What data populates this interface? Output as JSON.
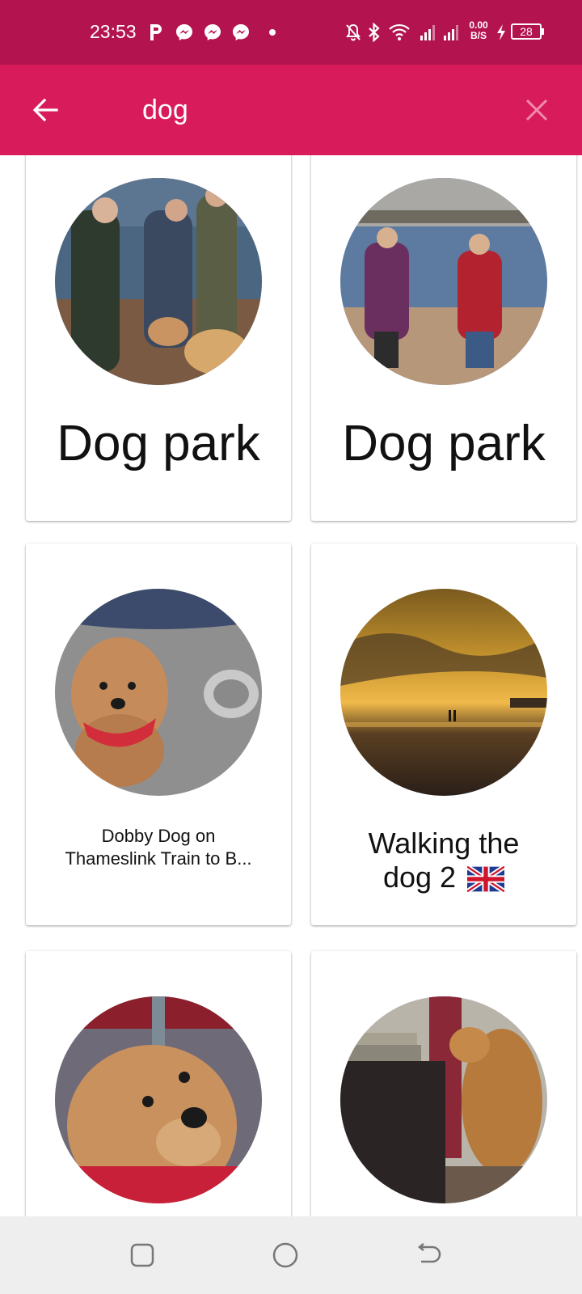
{
  "status_bar": {
    "time": "23:53",
    "notification_icons": [
      "parking-icon",
      "messenger-icon",
      "messenger-icon",
      "messenger-icon",
      "dot-icon"
    ],
    "right_icons": [
      "bell-off-icon",
      "bluetooth-icon",
      "wifi-icon",
      "signal-icon",
      "signal-icon",
      "net-speed-icon",
      "charging-icon",
      "battery-icon"
    ],
    "net_speed_value": "0.00",
    "net_speed_unit": "B/S",
    "battery_level": "28"
  },
  "app_bar": {
    "back_icon": "arrow-left-icon",
    "search_value": "dog",
    "clear_icon": "close-icon"
  },
  "results": [
    {
      "title": "Dog park",
      "image": "people-with-dogs-on-riverbank"
    },
    {
      "title": "Dog park",
      "image": "people-walking-dogs-on-beach"
    },
    {
      "title_line1": "Dobby Dog on",
      "title_line2": "Thameslink Train to B...",
      "image": "cockapoo-on-train-floor"
    },
    {
      "title_line1": "Walking the",
      "title_line2": "dog 2",
      "flag": "🇬🇧",
      "image": "sunset-beach-walk"
    },
    {
      "title": "",
      "image": "cockapoo-closeup"
    },
    {
      "title": "",
      "image": "dog-in-living-room"
    }
  ],
  "nav_bar": {
    "icons": [
      "recent-apps-icon",
      "home-icon",
      "back-icon"
    ]
  },
  "colors": {
    "status_bar": "#b3144f",
    "app_bar": "#d81b5b",
    "nav_bar": "#eeeeee"
  }
}
